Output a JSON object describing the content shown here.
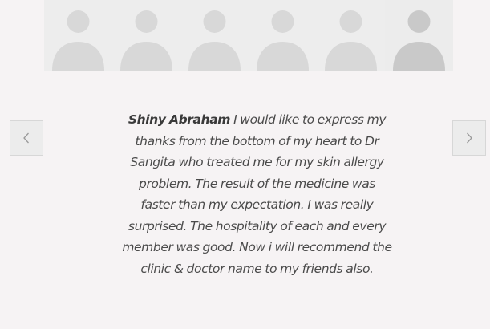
{
  "testimonials": {
    "thumbnails": [
      {
        "icon": "person-placeholder-icon",
        "active": false
      },
      {
        "icon": "person-placeholder-icon",
        "active": false
      },
      {
        "icon": "person-placeholder-icon",
        "active": false
      },
      {
        "icon": "person-placeholder-icon",
        "active": false
      },
      {
        "icon": "person-placeholder-icon",
        "active": false
      },
      {
        "icon": "person-placeholder-icon",
        "active": true
      }
    ],
    "author": "Shiny Abraham",
    "text": "I would like to express my thanks from the bottom of my heart to Dr Sangita who treated me for my skin allergy problem. The result of the medicine was faster than my expectation. I was really surprised. The hospitality of each and every member was good. Now i will recommend the clinic & doctor name to my friends also.",
    "prev_icon": "chevron-left-icon",
    "next_icon": "chevron-right-icon"
  },
  "colors": {
    "background": "#f6f3f4",
    "active_indicator": "#2f8ee0",
    "silhouette": "#d8d8d8",
    "silhouette_active": "#c9c9c9",
    "text": "#4a4a4a"
  }
}
